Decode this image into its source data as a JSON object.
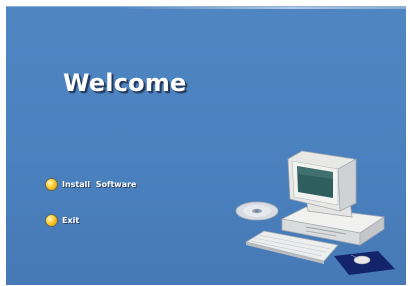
{
  "window": {
    "background_color": "#4a81be"
  },
  "header": {
    "title": "Welcome"
  },
  "menu": {
    "items": [
      {
        "label": "Install  Software",
        "icon": "bullet-icon"
      },
      {
        "label": "Exit",
        "icon": "bullet-icon"
      }
    ]
  },
  "illustration": {
    "items": [
      "compact-disc-icon",
      "computer-monitor-icon",
      "desktop-tower-icon",
      "keyboard-icon",
      "mouse-icon",
      "mouse-pad-icon"
    ]
  },
  "colors": {
    "bullet": "#ffcc33",
    "text": "#ffffff",
    "mouse_pad": "#14246b"
  }
}
